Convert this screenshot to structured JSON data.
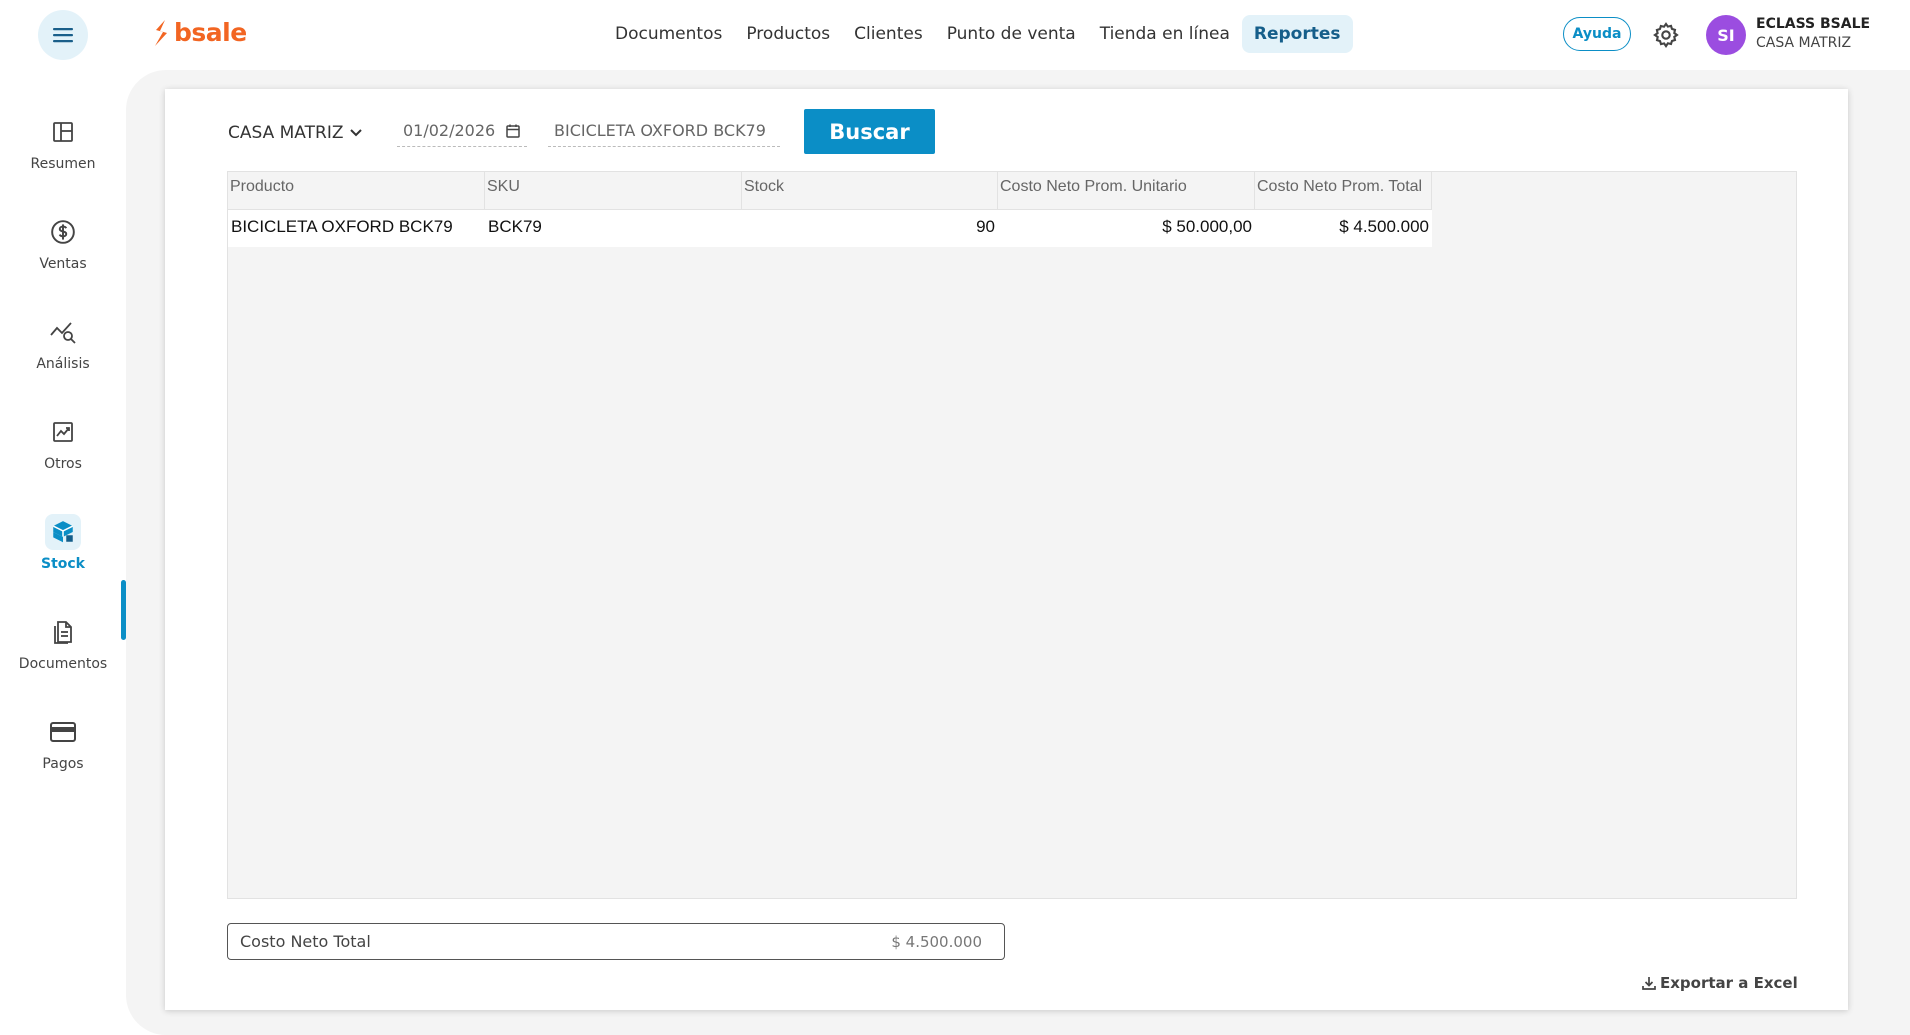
{
  "header": {
    "logo_text": "bsale",
    "nav": [
      {
        "label": "Documentos",
        "active": false
      },
      {
        "label": "Productos",
        "active": false
      },
      {
        "label": "Clientes",
        "active": false
      },
      {
        "label": "Punto de venta",
        "active": false
      },
      {
        "label": "Tienda en línea",
        "active": false
      },
      {
        "label": "Reportes",
        "active": true
      }
    ],
    "help_label": "Ayuda",
    "avatar_initials": "SI",
    "user_name": "ECLASS BSALE",
    "user_branch": "CASA MATRIZ"
  },
  "sidebar": {
    "items": [
      {
        "label": "Resumen",
        "icon": "layout-icon"
      },
      {
        "label": "Ventas",
        "icon": "dollar-icon"
      },
      {
        "label": "Análisis",
        "icon": "analysis-icon"
      },
      {
        "label": "Otros",
        "icon": "chart-icon"
      },
      {
        "label": "Stock",
        "icon": "box-icon",
        "active": true
      },
      {
        "label": "Documentos",
        "icon": "document-icon"
      },
      {
        "label": "Pagos",
        "icon": "card-icon"
      }
    ]
  },
  "filters": {
    "branch": "CASA MATRIZ",
    "date": "01/02/2026",
    "search_value": "BICICLETA OXFORD BCK79",
    "search_button": "Buscar"
  },
  "table": {
    "columns": [
      "Producto",
      "SKU",
      "Stock",
      "Costo Neto Prom. Unitario",
      "Costo Neto Prom. Total"
    ],
    "rows": [
      [
        "BICICLETA OXFORD BCK79",
        "BCK79",
        "90",
        "$ 50.000,00",
        "$ 4.500.000"
      ]
    ]
  },
  "summary": {
    "total_label": "Costo Neto Total",
    "total_value": "$ 4.500.000"
  },
  "export_label": "Exportar a Excel",
  "colors": {
    "accent": "#0b8ec6",
    "brand": "#f26522",
    "avatar": "#9b4de0"
  }
}
